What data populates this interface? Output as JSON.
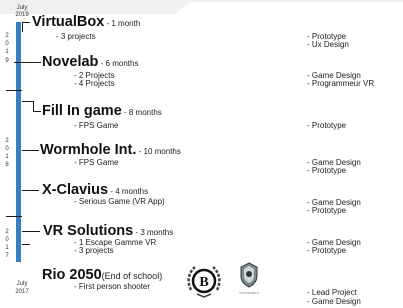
{
  "timeline": {
    "top_label_month": "July",
    "top_label_year": "2019",
    "bottom_label_month": "July",
    "bottom_label_year": "2017",
    "year_2019_digits": [
      "2",
      "0",
      "1",
      "9"
    ],
    "year_2018_digits": [
      "2",
      "0",
      "1",
      "8"
    ],
    "year_2017_digits": [
      "2",
      "0",
      "1",
      "7"
    ],
    "accent_color": "#3a7fc4"
  },
  "projects": [
    {
      "title": "VirtualBox",
      "duration": " - 1 month",
      "details": [
        "- 3 projects"
      ],
      "roles": [
        "- Prototype",
        "- Ux Design"
      ]
    },
    {
      "title": "Novelab",
      "duration": " - 6 months",
      "details": [
        "- 2 Projects",
        "- 4 Projects"
      ],
      "roles": [
        "- Game Design",
        "- Programmeur VR"
      ]
    },
    {
      "title": "Fill In game",
      "duration": " - 8 months",
      "details": [
        "- FPS Game"
      ],
      "roles": [
        "- Prototype"
      ]
    },
    {
      "title": "Wormhole Int.",
      "duration": " - 10 months",
      "details": [
        "- FPS Game"
      ],
      "roles": [
        "- Game Design",
        "- Prototype"
      ]
    },
    {
      "title": "X-Clavius",
      "duration": " - 4 months",
      "details": [
        "- Serious Game (VR App)"
      ],
      "roles": [
        "- Game Design",
        "- Prototype"
      ]
    },
    {
      "title": "VR Solutions",
      "duration": " - 3 months",
      "details": [
        "- 1 Escape Gamme VR",
        "- 3 projects"
      ],
      "roles": [
        "- Game Design",
        "- Prototype"
      ]
    },
    {
      "title": "Rio 2050",
      "title_suffix": "(End of school)",
      "details": [
        "- First person shooter"
      ],
      "roles": [
        "- Lead Project",
        "- Game Design"
      ]
    }
  ],
  "badges": {
    "badge_b_letter": "B",
    "badge_caption": "Nominated"
  }
}
